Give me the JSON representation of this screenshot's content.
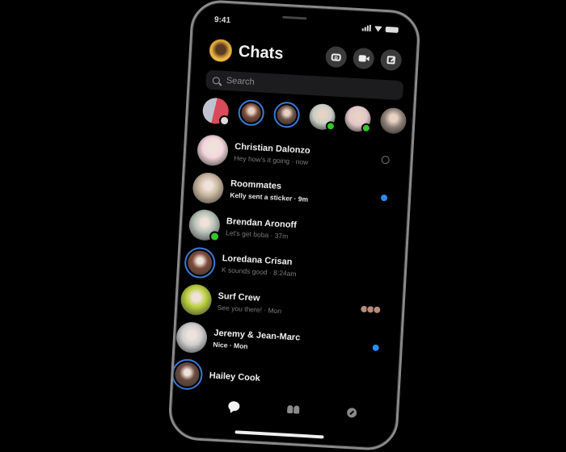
{
  "status_bar": {
    "time": "9:41"
  },
  "header": {
    "title": "Chats",
    "buttons": [
      {
        "icon": "camera-icon",
        "label": "Camera"
      },
      {
        "icon": "video-icon",
        "label": "Video call"
      },
      {
        "icon": "compose-icon",
        "label": "New message"
      }
    ]
  },
  "search": {
    "placeholder": "Search"
  },
  "stories": [
    {
      "kind": "add-story",
      "ring": false,
      "online": false,
      "color": "#c9636e"
    },
    {
      "kind": "story",
      "ring": true,
      "online": false,
      "color": "#7b4a38"
    },
    {
      "kind": "story",
      "ring": true,
      "online": false,
      "color": "#6d5346"
    },
    {
      "kind": "contact",
      "ring": false,
      "online": true,
      "color": "#c8cfc6"
    },
    {
      "kind": "contact",
      "ring": false,
      "online": true,
      "color": "#e2c6c8"
    },
    {
      "kind": "contact",
      "ring": false,
      "online": false,
      "color": "#8c7f76"
    }
  ],
  "chats": [
    {
      "name": "Christian Dalonzo",
      "preview": "Hey how's it going · now",
      "unread": false,
      "status": "read",
      "ring": false,
      "online": false,
      "avatar_color": "#f3d6dc"
    },
    {
      "name": "Roommates",
      "preview": "Kelly sent a sticker · 9m",
      "unread": true,
      "status": "unread",
      "ring": false,
      "online": false,
      "avatar_color": "#c9b7a0"
    },
    {
      "name": "Brendan Aronoff",
      "preview": "Let's get boba · 37m",
      "unread": false,
      "status": "none",
      "ring": false,
      "online": true,
      "avatar_color": "#b7c2b8"
    },
    {
      "name": "Loredana Crisan",
      "preview": "K sounds good · 8:24am",
      "unread": false,
      "status": "none",
      "ring": true,
      "online": false,
      "avatar_color": "#7c4a3a"
    },
    {
      "name": "Surf Crew",
      "preview": "See you there! · Mon",
      "unread": false,
      "status": "seen-by",
      "ring": false,
      "online": false,
      "avatar_color": "#b9cf3b"
    },
    {
      "name": "Jeremy & Jean-Marc",
      "preview": "Nice · Mon",
      "unread": true,
      "status": "unread",
      "ring": false,
      "online": false,
      "avatar_color": "#cfcfcf"
    },
    {
      "name": "Hailey Cook",
      "preview": "",
      "unread": false,
      "status": "none",
      "ring": true,
      "online": false,
      "avatar_color": "#6b4a3e"
    }
  ],
  "tabbar": [
    {
      "icon": "chat-bubble-icon",
      "label": "Chats",
      "active": true
    },
    {
      "icon": "people-icon",
      "label": "People",
      "active": false
    },
    {
      "icon": "discover-icon",
      "label": "Discover",
      "active": false
    }
  ],
  "colors": {
    "accent": "#2b8cf5",
    "online": "#35c42e",
    "story_ring": "#3a7bd5",
    "background": "#000000"
  }
}
